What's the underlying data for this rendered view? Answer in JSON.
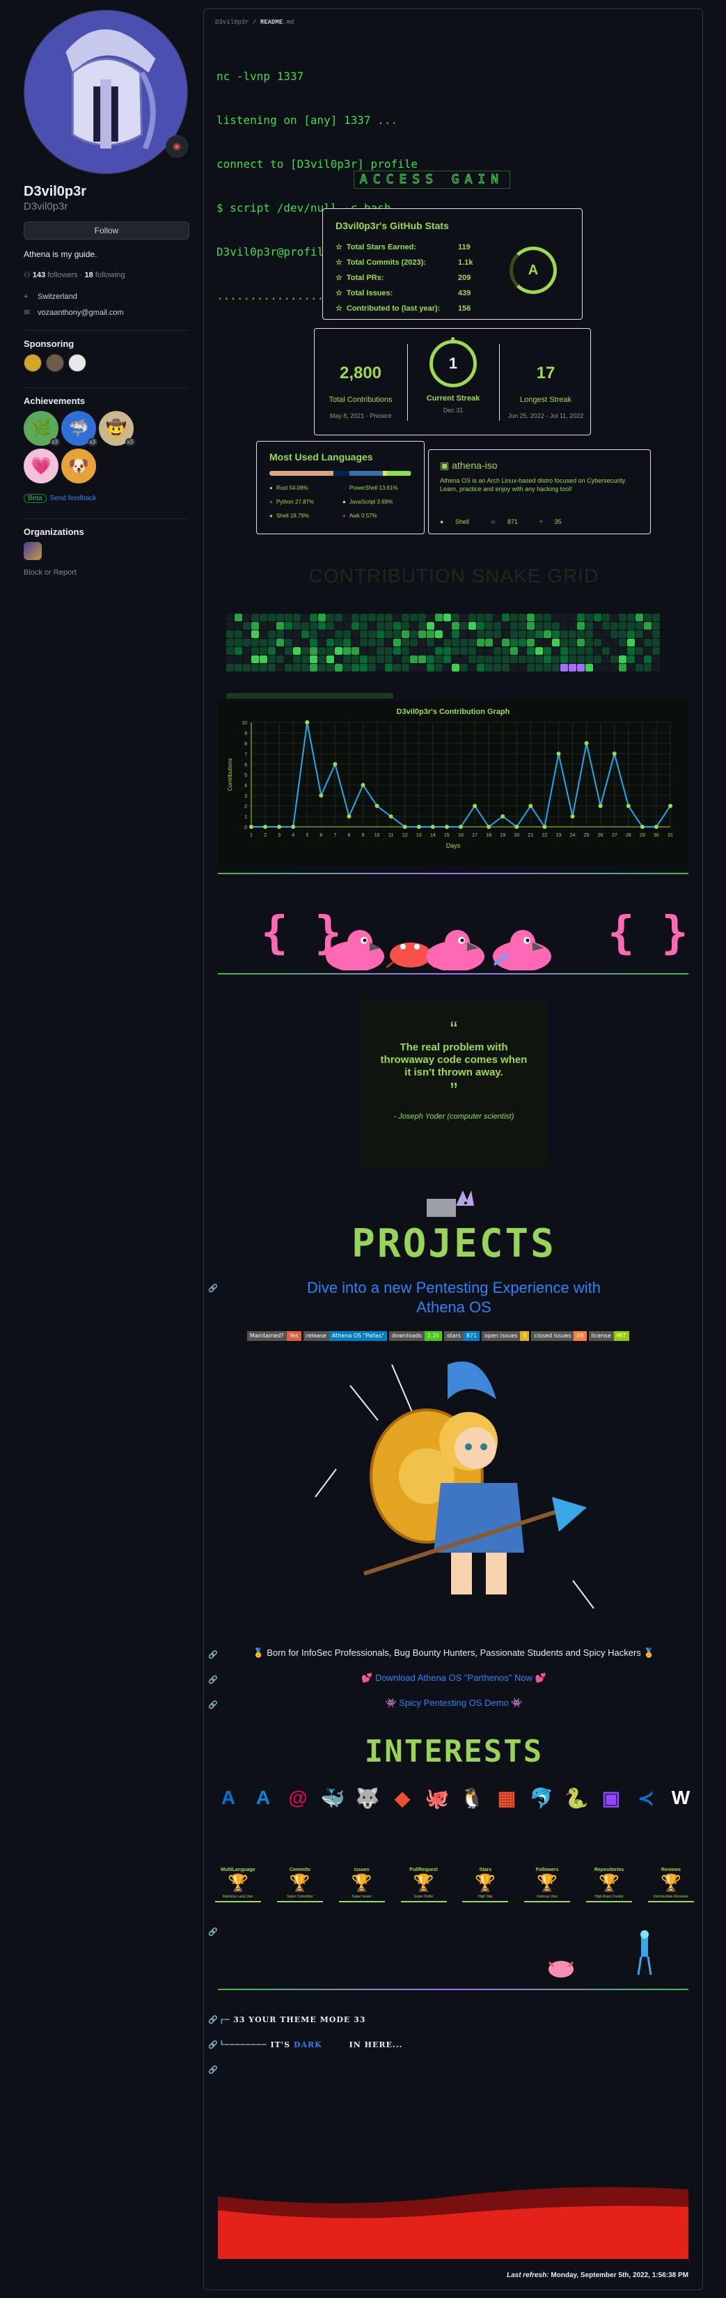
{
  "profile": {
    "name": "D3vil0p3r",
    "login": "D3vil0p3r",
    "follow_label": "Follow",
    "bio": "Athena is my guide.",
    "followers_count": "143",
    "followers_label": "followers",
    "following_count": "18",
    "following_label": "following",
    "location": "Switzerland",
    "email": "vozaanthony@gmail.com"
  },
  "sidebar": {
    "sponsoring_title": "Sponsoring",
    "achievements_title": "Achievements",
    "achievement_counts": [
      "x3",
      "x3",
      "x3"
    ],
    "beta_label": "Beta",
    "feedback_label": "Send feedback",
    "organizations_title": "Organizations",
    "block_label": "Block or Report"
  },
  "readme": {
    "path_user": "D3vil0p3r",
    "path_sep": " / ",
    "path_file": "README",
    "path_ext": ".md",
    "terminal_lines": [
      "nc -lvnp 1337",
      "listening on [any] 1337 ...",
      "connect to [D3vil0p3r] profile",
      "$ script /dev/null -c bash",
      "D3vil0p3r@profile:~$ ./exploit",
      "..............................."
    ],
    "access_banner": "ACCESS GAIN"
  },
  "stats": {
    "title": "D3vil0p3r's GitHub Stats",
    "rows": [
      {
        "label": "Total Stars Earned:",
        "value": "119"
      },
      {
        "label": "Total Commits (2023):",
        "value": "1.1k"
      },
      {
        "label": "Total PRs:",
        "value": "209"
      },
      {
        "label": "Total Issues:",
        "value": "439"
      },
      {
        "label": "Contributed to (last year):",
        "value": "156"
      }
    ],
    "grade": "A"
  },
  "streak": {
    "total_value": "2,800",
    "total_label": "Total Contributions",
    "total_range": "May 8, 2021 - Present",
    "current_value": "1",
    "current_label": "Current Streak",
    "current_range": "Dec 31",
    "longest_value": "17",
    "longest_label": "Longest Streak",
    "longest_range": "Jun 25, 2022 - Jul 11, 2022"
  },
  "languages": {
    "title": "Most Used Languages",
    "items": [
      {
        "name": "Rust 54.06%",
        "color": "#dea584",
        "pct": 54.06
      },
      {
        "name": "PowerShell 13.61%",
        "color": "#012456",
        "pct": 13.61
      },
      {
        "name": "Python 27.87%",
        "color": "#3572A5",
        "pct": 27.87
      },
      {
        "name": "JavaScript 3.69%",
        "color": "#f1e05a",
        "pct": 3.69
      },
      {
        "name": "Shell 19.79%",
        "color": "#89e051",
        "pct": 19.79
      },
      {
        "name": "Awk 0.57%",
        "color": "#c22d40",
        "pct": 0.57
      }
    ]
  },
  "repo": {
    "name": "athena-iso",
    "description": "Athena OS is an Arch Linux-based distro focused on Cybersecurity. Learn, practice and enjoy with any hacking tool!",
    "language": "Shell",
    "stars": "871",
    "forks": "35"
  },
  "snake": {
    "title": "CONTRIBUTION SNAKE GRID"
  },
  "chart_data": {
    "type": "line",
    "title": "D3vil0p3r's Contribution Graph",
    "xlabel": "Days",
    "ylabel": "Contributions",
    "x": [
      1,
      2,
      3,
      4,
      5,
      6,
      7,
      8,
      9,
      10,
      11,
      12,
      13,
      14,
      15,
      16,
      17,
      18,
      19,
      20,
      21,
      22,
      23,
      24,
      25,
      26,
      27,
      28,
      29,
      30,
      31
    ],
    "values": [
      0,
      0,
      0,
      0,
      10,
      3,
      6,
      1,
      4,
      2,
      1,
      0,
      0,
      0,
      0,
      0,
      2,
      0,
      1,
      0,
      2,
      0,
      7,
      1,
      8,
      2,
      7,
      2,
      0,
      0,
      2
    ],
    "ylim": [
      0,
      10
    ],
    "yticks": [
      0,
      1,
      2,
      3,
      4,
      5,
      6,
      7,
      8,
      9,
      10
    ],
    "grid": true
  },
  "quote": {
    "open_mark": "“",
    "text": "The real problem with throwaway code comes when it isn't thrown away.",
    "close_mark": "”",
    "author": "- Joseph Yoder (computer scientist)"
  },
  "projects": {
    "title": "PROJECTS",
    "headline_1": "Dive into a new Pentesting Experience with",
    "headline_2": "Athena OS",
    "badges": [
      {
        "l": "Maintained?",
        "r": "Yes",
        "c": "#e05d44"
      },
      {
        "l": "release",
        "r": "Athena OS \"Pallas\"",
        "c": "#007ec6"
      },
      {
        "l": "downloads",
        "r": "2.2k",
        "c": "#4c1"
      },
      {
        "l": "stars",
        "r": "871",
        "c": "#007ec6"
      },
      {
        "l": "open issues",
        "r": "5",
        "c": "#dfb317"
      },
      {
        "l": "closed issues",
        "r": "89",
        "c": "#fe7d37"
      },
      {
        "l": "license",
        "r": "MIT",
        "c": "#97ca00"
      }
    ],
    "born": "🏅 Born for InfoSec Professionals, Bug Bounty Hunters, Passionate Students and Spicy Hackers 🏅",
    "download": "💕 Download Athena OS \"Parthenos\" Now 💕",
    "demo": "👾 Spicy Pentesting OS Demo 👾"
  },
  "interests": {
    "title": "INTERESTS",
    "techs": [
      {
        "name": "azure-devops-icon",
        "glyph": "A",
        "color": "#0078d7"
      },
      {
        "name": "azure-icon",
        "glyph": "A",
        "color": "#0089d6"
      },
      {
        "name": "debian-icon",
        "glyph": "@",
        "color": "#d70a53"
      },
      {
        "name": "docker-icon",
        "glyph": "🐳",
        "color": "#2496ed"
      },
      {
        "name": "gimp-icon",
        "glyph": "🐺",
        "color": "#8e7b5b"
      },
      {
        "name": "git-icon",
        "glyph": "◆",
        "color": "#f05032"
      },
      {
        "name": "github-icon",
        "glyph": "🐙",
        "color": "#ffffff"
      },
      {
        "name": "linux-icon",
        "glyph": "🐧",
        "color": "#fcc624"
      },
      {
        "name": "microsoft-icon",
        "glyph": "▦",
        "color": "#f25022"
      },
      {
        "name": "mysql-icon",
        "glyph": "🐬",
        "color": "#4479a1"
      },
      {
        "name": "python-icon",
        "glyph": "🐍",
        "color": "#3776ab"
      },
      {
        "name": "twitch-icon",
        "glyph": "▣",
        "color": "#9146ff"
      },
      {
        "name": "vscode-icon",
        "glyph": "≺",
        "color": "#007acc"
      },
      {
        "name": "wikipedia-icon",
        "glyph": "W",
        "color": "#ffffff"
      }
    ],
    "trophies": [
      {
        "title": "MultiLanguage",
        "rank": "Rainbow Lang User"
      },
      {
        "title": "Commits",
        "rank": "Super Committer"
      },
      {
        "title": "Issues",
        "rank": "Super Issuer"
      },
      {
        "title": "PullRequest",
        "rank": "Super Puller"
      },
      {
        "title": "Stars",
        "rank": "High Star"
      },
      {
        "title": "Followers",
        "rank": "Famous User"
      },
      {
        "title": "Repositories",
        "rank": "High Repo Creator"
      },
      {
        "title": "Reviews",
        "rank": "Intermediate Reviewer"
      }
    ]
  },
  "theme": {
    "line1": "YOUR THEME MODE",
    "line2_a": "IT'S",
    "line2_b": "DARK",
    "line2_c": "IN HERE..."
  },
  "footer": {
    "refresh_label": "Last refresh:",
    "refresh_value": "Monday, September 5th, 2022, 1:56:38 PM"
  }
}
